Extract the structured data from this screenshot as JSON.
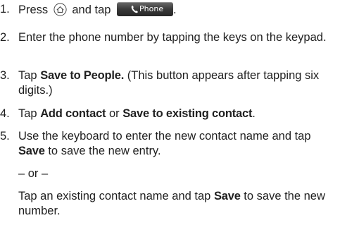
{
  "steps": [
    {
      "num": "1.",
      "press": "Press",
      "and_tap": "and tap",
      "end": ".",
      "home_icon": "home-icon",
      "phone_button_label": "Phone"
    },
    {
      "num": "2.",
      "text": "Enter the phone number by tapping the keys on the keypad."
    },
    {
      "num": "3.",
      "tap": "Tap",
      "bold": "Save to People.",
      "rest": "(This button appears after tapping six digits.)"
    },
    {
      "num": "4.",
      "tap": "Tap",
      "bold1": "Add contact",
      "or": "or",
      "bold2": "Save to existing contact",
      "end": "."
    },
    {
      "num": "5.",
      "lead": "Use the keyboard to enter the new contact name and tap",
      "bold": "Save",
      "rest": "to save the new entry.",
      "or_line": "– or –",
      "alt_lead": "Tap an existing contact name and tap",
      "alt_bold": "Save",
      "alt_rest": "to save the new number."
    }
  ]
}
